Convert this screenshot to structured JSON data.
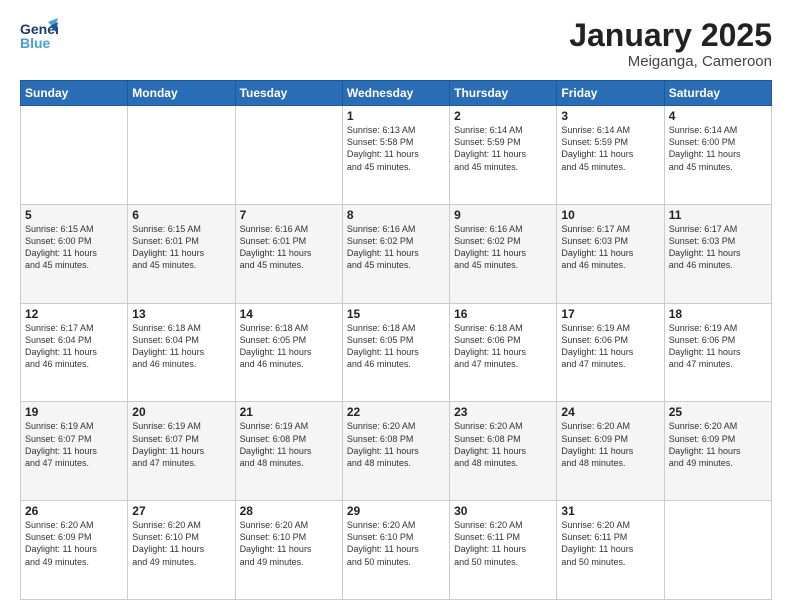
{
  "header": {
    "logo_line1": "General",
    "logo_line2": "Blue",
    "title": "January 2025",
    "subtitle": "Meiganga, Cameroon"
  },
  "weekdays": [
    "Sunday",
    "Monday",
    "Tuesday",
    "Wednesday",
    "Thursday",
    "Friday",
    "Saturday"
  ],
  "weeks": [
    [
      {
        "day": "",
        "info": ""
      },
      {
        "day": "",
        "info": ""
      },
      {
        "day": "",
        "info": ""
      },
      {
        "day": "1",
        "info": "Sunrise: 6:13 AM\nSunset: 5:58 PM\nDaylight: 11 hours\nand 45 minutes."
      },
      {
        "day": "2",
        "info": "Sunrise: 6:14 AM\nSunset: 5:59 PM\nDaylight: 11 hours\nand 45 minutes."
      },
      {
        "day": "3",
        "info": "Sunrise: 6:14 AM\nSunset: 5:59 PM\nDaylight: 11 hours\nand 45 minutes."
      },
      {
        "day": "4",
        "info": "Sunrise: 6:14 AM\nSunset: 6:00 PM\nDaylight: 11 hours\nand 45 minutes."
      }
    ],
    [
      {
        "day": "5",
        "info": "Sunrise: 6:15 AM\nSunset: 6:00 PM\nDaylight: 11 hours\nand 45 minutes."
      },
      {
        "day": "6",
        "info": "Sunrise: 6:15 AM\nSunset: 6:01 PM\nDaylight: 11 hours\nand 45 minutes."
      },
      {
        "day": "7",
        "info": "Sunrise: 6:16 AM\nSunset: 6:01 PM\nDaylight: 11 hours\nand 45 minutes."
      },
      {
        "day": "8",
        "info": "Sunrise: 6:16 AM\nSunset: 6:02 PM\nDaylight: 11 hours\nand 45 minutes."
      },
      {
        "day": "9",
        "info": "Sunrise: 6:16 AM\nSunset: 6:02 PM\nDaylight: 11 hours\nand 45 minutes."
      },
      {
        "day": "10",
        "info": "Sunrise: 6:17 AM\nSunset: 6:03 PM\nDaylight: 11 hours\nand 46 minutes."
      },
      {
        "day": "11",
        "info": "Sunrise: 6:17 AM\nSunset: 6:03 PM\nDaylight: 11 hours\nand 46 minutes."
      }
    ],
    [
      {
        "day": "12",
        "info": "Sunrise: 6:17 AM\nSunset: 6:04 PM\nDaylight: 11 hours\nand 46 minutes."
      },
      {
        "day": "13",
        "info": "Sunrise: 6:18 AM\nSunset: 6:04 PM\nDaylight: 11 hours\nand 46 minutes."
      },
      {
        "day": "14",
        "info": "Sunrise: 6:18 AM\nSunset: 6:05 PM\nDaylight: 11 hours\nand 46 minutes."
      },
      {
        "day": "15",
        "info": "Sunrise: 6:18 AM\nSunset: 6:05 PM\nDaylight: 11 hours\nand 46 minutes."
      },
      {
        "day": "16",
        "info": "Sunrise: 6:18 AM\nSunset: 6:06 PM\nDaylight: 11 hours\nand 47 minutes."
      },
      {
        "day": "17",
        "info": "Sunrise: 6:19 AM\nSunset: 6:06 PM\nDaylight: 11 hours\nand 47 minutes."
      },
      {
        "day": "18",
        "info": "Sunrise: 6:19 AM\nSunset: 6:06 PM\nDaylight: 11 hours\nand 47 minutes."
      }
    ],
    [
      {
        "day": "19",
        "info": "Sunrise: 6:19 AM\nSunset: 6:07 PM\nDaylight: 11 hours\nand 47 minutes."
      },
      {
        "day": "20",
        "info": "Sunrise: 6:19 AM\nSunset: 6:07 PM\nDaylight: 11 hours\nand 47 minutes."
      },
      {
        "day": "21",
        "info": "Sunrise: 6:19 AM\nSunset: 6:08 PM\nDaylight: 11 hours\nand 48 minutes."
      },
      {
        "day": "22",
        "info": "Sunrise: 6:20 AM\nSunset: 6:08 PM\nDaylight: 11 hours\nand 48 minutes."
      },
      {
        "day": "23",
        "info": "Sunrise: 6:20 AM\nSunset: 6:08 PM\nDaylight: 11 hours\nand 48 minutes."
      },
      {
        "day": "24",
        "info": "Sunrise: 6:20 AM\nSunset: 6:09 PM\nDaylight: 11 hours\nand 48 minutes."
      },
      {
        "day": "25",
        "info": "Sunrise: 6:20 AM\nSunset: 6:09 PM\nDaylight: 11 hours\nand 49 minutes."
      }
    ],
    [
      {
        "day": "26",
        "info": "Sunrise: 6:20 AM\nSunset: 6:09 PM\nDaylight: 11 hours\nand 49 minutes."
      },
      {
        "day": "27",
        "info": "Sunrise: 6:20 AM\nSunset: 6:10 PM\nDaylight: 11 hours\nand 49 minutes."
      },
      {
        "day": "28",
        "info": "Sunrise: 6:20 AM\nSunset: 6:10 PM\nDaylight: 11 hours\nand 49 minutes."
      },
      {
        "day": "29",
        "info": "Sunrise: 6:20 AM\nSunset: 6:10 PM\nDaylight: 11 hours\nand 50 minutes."
      },
      {
        "day": "30",
        "info": "Sunrise: 6:20 AM\nSunset: 6:11 PM\nDaylight: 11 hours\nand 50 minutes."
      },
      {
        "day": "31",
        "info": "Sunrise: 6:20 AM\nSunset: 6:11 PM\nDaylight: 11 hours\nand 50 minutes."
      },
      {
        "day": "",
        "info": ""
      }
    ]
  ]
}
